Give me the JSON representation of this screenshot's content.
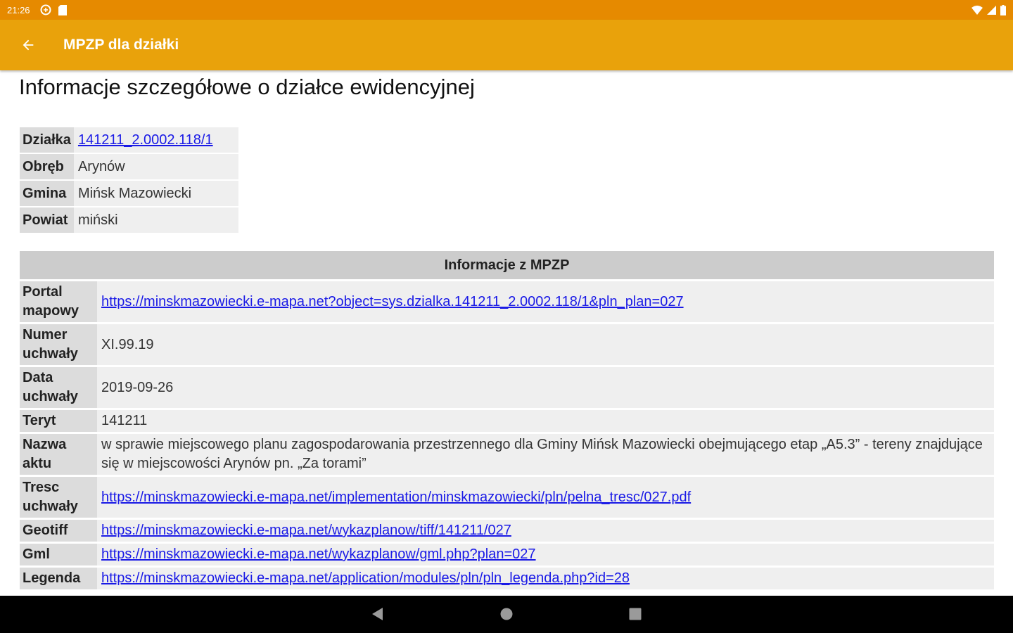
{
  "status": {
    "time": "21:26"
  },
  "appbar": {
    "title": "MPZP dla działki"
  },
  "page": {
    "heading": "Informacje szczegółowe o działce ewidencyjnej"
  },
  "parcel": [
    {
      "label": "Działka",
      "value": "141211_2.0002.118/1",
      "link": true
    },
    {
      "label": "Obręb",
      "value": "Arynów",
      "link": false
    },
    {
      "label": "Gmina",
      "value": "Mińsk Mazowiecki",
      "link": false
    },
    {
      "label": "Powiat",
      "value": "miński",
      "link": false
    }
  ],
  "mpzp": {
    "header": "Informacje z MPZP",
    "rows": [
      {
        "label": "Portal mapowy",
        "value": "https://minskmazowiecki.e-mapa.net?object=sys.dzialka.141211_2.0002.118/1&pln_plan=027",
        "link": true
      },
      {
        "label": "Numer uchwały",
        "value": "XI.99.19",
        "link": false
      },
      {
        "label": "Data uchwały",
        "value": "2019-09-26",
        "link": false
      },
      {
        "label": "Teryt",
        "value": "141211",
        "link": false
      },
      {
        "label": "Nazwa aktu",
        "value": "w sprawie miejscowego planu zagospodarowania przestrzennego dla Gminy Mińsk Mazowiecki obejmującego etap „A5.3” - tereny znajdujące się w miejscowości Arynów pn. „Za torami”",
        "link": false
      },
      {
        "label": "Tresc uchwały",
        "value": "https://minskmazowiecki.e-mapa.net/implementation/minskmazowiecki/pln/pelna_tresc/027.pdf",
        "link": true
      },
      {
        "label": "Geotiff",
        "value": "https://minskmazowiecki.e-mapa.net/wykazplanow/tiff/141211/027",
        "link": true
      },
      {
        "label": "Gml",
        "value": "https://minskmazowiecki.e-mapa.net/wykazplanow/gml.php?plan=027",
        "link": true
      },
      {
        "label": "Legenda",
        "value": "https://minskmazowiecki.e-mapa.net/application/modules/pln/pln_legenda.php?id=28",
        "link": true
      }
    ]
  },
  "icons": {
    "back": "arrow-back-icon",
    "nav_back": "triangle-back-icon",
    "nav_home": "circle-home-icon",
    "nav_recents": "square-recents-icon"
  },
  "colors": {
    "statusbar": "#e68a00",
    "appbar": "#e9a20b",
    "link": "#1a1ae6"
  }
}
